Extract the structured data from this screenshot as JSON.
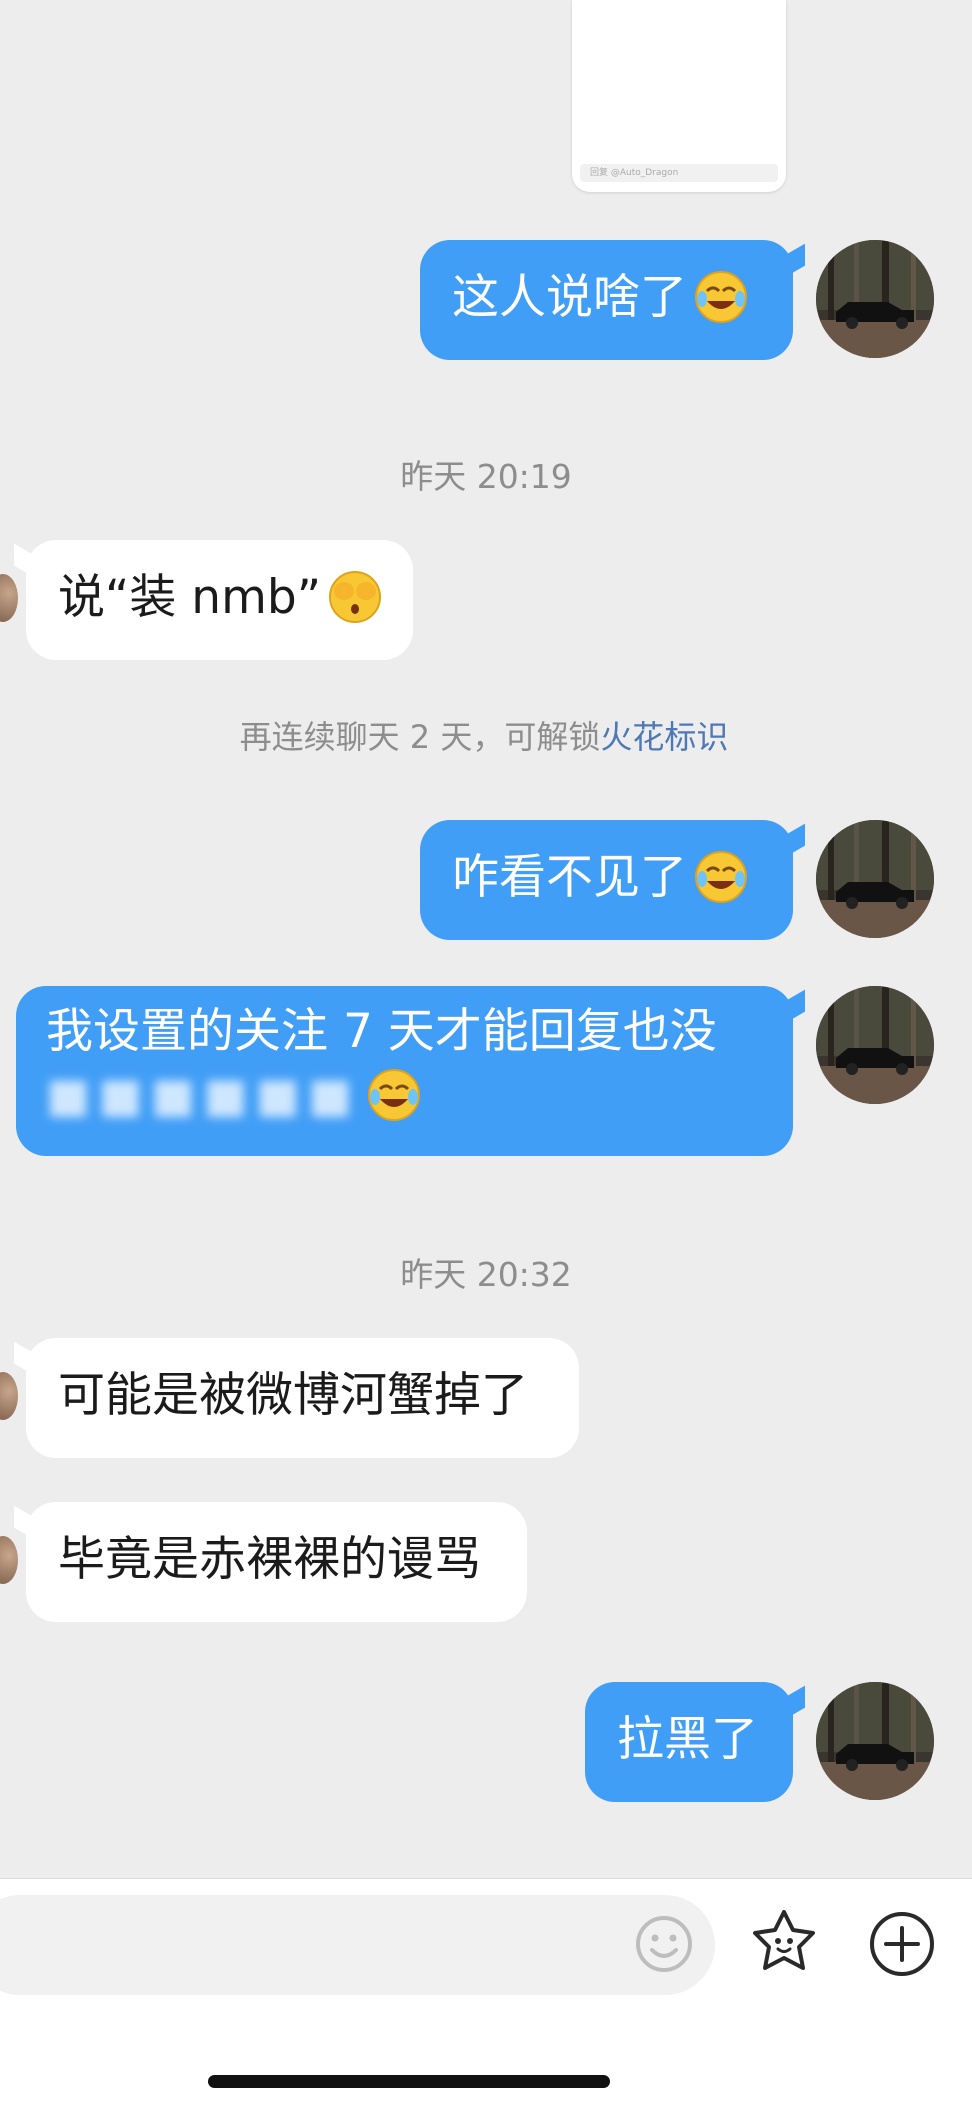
{
  "shared_card": {
    "caption": "回复 @Auto_Dragon"
  },
  "messages": [
    {
      "id": "m1",
      "direction": "out",
      "text": "这人说啥了",
      "emoji": "laugh-cry-emoji"
    },
    {
      "id": "t1",
      "timestamp": "昨天 20:19"
    },
    {
      "id": "m2",
      "direction": "in",
      "text": "说“装 nmb”",
      "emoji": "see-no-evil-emoji"
    },
    {
      "id": "n1",
      "notice_prefix": "再连续聊天 2 天，可解锁",
      "notice_link": "火花标识"
    },
    {
      "id": "m3",
      "direction": "out",
      "text": "咋看不见了",
      "emoji": "laugh-cry-emoji"
    },
    {
      "id": "m4",
      "direction": "out",
      "line1": "我设置的关注 7 天才能回复也没",
      "line2_blurred": "■■■■■■",
      "emoji": "laugh-cry-emoji"
    },
    {
      "id": "t2",
      "timestamp": "昨天 20:32"
    },
    {
      "id": "m5",
      "direction": "in",
      "text": "可能是被微博河蟹掉了"
    },
    {
      "id": "m6",
      "direction": "in",
      "text": "毕竟是赤裸裸的谩骂"
    },
    {
      "id": "m7",
      "direction": "out",
      "text": "拉黑了"
    }
  ],
  "input_bar": {
    "input_placeholder": "",
    "emoji_icon": "smiley-icon",
    "sticker_icon": "star-face-icon",
    "more_icon": "plus-circle-icon"
  },
  "colors": {
    "outgoing_bubble": "#419ef6",
    "incoming_bubble": "#ffffff",
    "background": "#ededed",
    "notice_link": "#4f79b4"
  }
}
